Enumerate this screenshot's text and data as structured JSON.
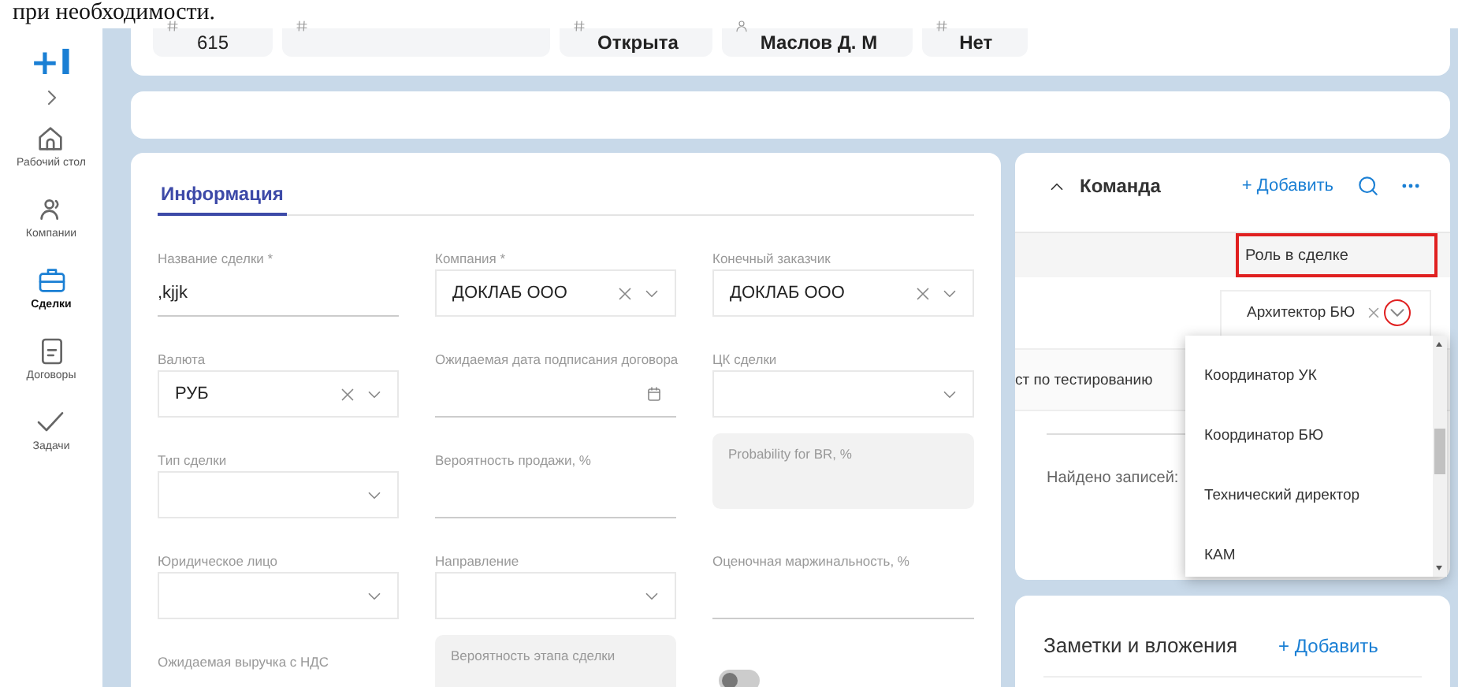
{
  "document_text": "при необходимости.",
  "sidebar": {
    "logo": "+I",
    "items": [
      {
        "label": "Рабочий стол",
        "selected": false
      },
      {
        "label": "Компании",
        "selected": false
      },
      {
        "label": "Сделки",
        "selected": true
      },
      {
        "label": "Договоры",
        "selected": false
      },
      {
        "label": "Задачи",
        "selected": false
      }
    ]
  },
  "header_chips": [
    {
      "kind": "text",
      "value": "615"
    },
    {
      "kind": "blank"
    },
    {
      "kind": "text",
      "value": "Открыта"
    },
    {
      "kind": "text",
      "value": "Маслов Д. М"
    },
    {
      "kind": "text",
      "value": "Нет"
    }
  ],
  "info": {
    "tabs": [
      {
        "label": "Информация",
        "selected": true
      }
    ],
    "fields": [
      {
        "label": "Название сделки *",
        "kind": "text",
        "value": ",kjjk"
      },
      {
        "label": "Компания *",
        "kind": "select",
        "value": "ДОКЛАБ ООО",
        "clearable": true
      },
      {
        "label": "Конечный заказчик",
        "kind": "select",
        "value": "ДОКЛАБ ООО",
        "clearable": true
      },
      {
        "label": "Валюта",
        "kind": "select",
        "value": "РУБ",
        "clearable": true
      },
      {
        "label": "Ожидаемая дата подписания договора",
        "kind": "date"
      },
      {
        "label": "ЦК сделки",
        "kind": "select",
        "clearable": false
      },
      {
        "label": "Тип сделки",
        "kind": "select",
        "clearable": false
      },
      {
        "label": "Вероятность продажи, %",
        "kind": "text"
      },
      {
        "label": "Probability for BR, %",
        "kind": "disabled"
      },
      {
        "label": "Юридическое лицо",
        "kind": "select",
        "clearable": false
      },
      {
        "label": "Направление",
        "kind": "select",
        "clearable": false
      },
      {
        "label": "Оценочная маржинальность, %",
        "kind": "text"
      },
      {
        "label": "Ожидаемая выручка с НДС",
        "kind": "label"
      },
      {
        "label": "Вероятность этапа сделки",
        "kind": "disabled"
      },
      {
        "kind": "toggle",
        "on": false
      }
    ]
  },
  "team": {
    "title": "Команда",
    "expanded": true,
    "add_label": "+ Добавить",
    "columns": [
      {
        "label": "Роль в сделке",
        "highlighted": true
      }
    ],
    "rows": [
      {
        "kind": "select",
        "value": "Архитектор БЮ",
        "chevron_highlighted": true
      },
      {
        "kind": "text",
        "value": "ст по тестированию"
      }
    ],
    "found": "Найдено записей:",
    "dropdown": {
      "options": [
        {
          "label": "Координатор УК",
          "selected": false
        },
        {
          "label": "Координатор БЮ",
          "selected": false
        },
        {
          "label": "Технический директор",
          "selected": false
        },
        {
          "label": "КАМ",
          "selected": false
        }
      ]
    }
  },
  "notes": {
    "title": "Заметки и вложения",
    "add_label": "+ Добавить"
  }
}
